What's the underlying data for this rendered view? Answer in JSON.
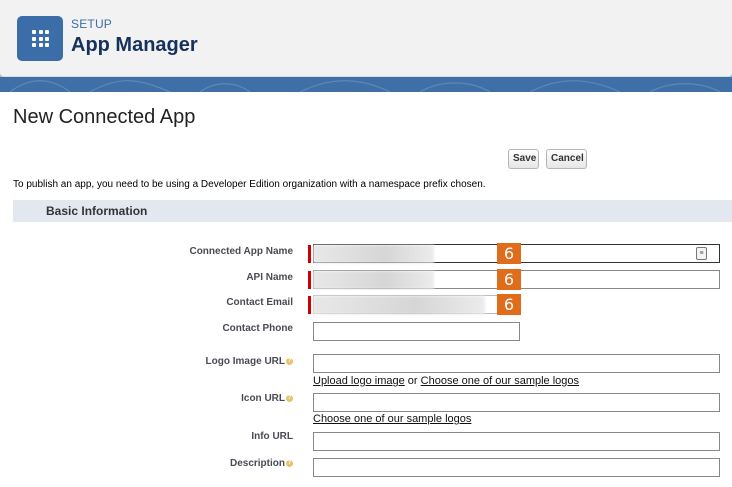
{
  "header": {
    "setup_label": "SETUP",
    "title": "App Manager",
    "app_icon": "app-launcher-grid-icon"
  },
  "page": {
    "title": "New Connected App",
    "save_label": "Save",
    "cancel_label": "Cancel",
    "intro_text": "To publish an app, you need to be using a Developer Edition organization with a namespace prefix chosen.",
    "section_title": "Basic Information"
  },
  "form": {
    "connected_app_name_label": "Connected App Name",
    "api_name_label": "API Name",
    "contact_email_label": "Contact Email",
    "contact_phone_label": "Contact Phone",
    "logo_image_url_label": "Logo Image URL",
    "icon_url_label": "Icon URL",
    "info_url_label": "Info URL",
    "description_label": "Description",
    "badge_value": "6",
    "upload_logo_link": "Upload logo image",
    "or_text": "or",
    "sample_logos_link": "Choose one of our sample logos",
    "sample_icons_link": "Choose one of our sample logos"
  }
}
